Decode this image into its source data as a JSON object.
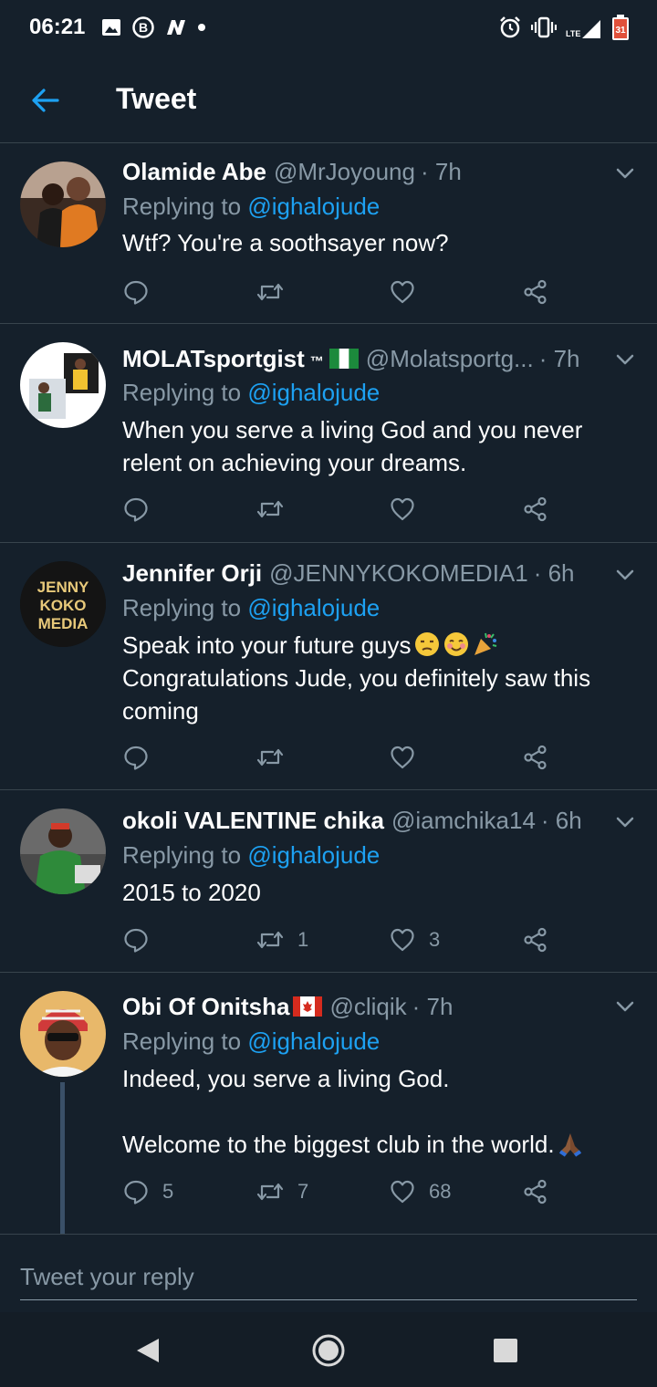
{
  "status_bar": {
    "time": "06:21",
    "left_icons": [
      "image-icon",
      "b-circle-icon",
      "n-icon",
      "dot-icon"
    ],
    "right_icons": [
      "alarm-icon",
      "vibrate-icon",
      "lte-signal-icon",
      "battery-icon"
    ],
    "network": "LTE",
    "battery": "31"
  },
  "header": {
    "title": "Tweet"
  },
  "tweets": [
    {
      "name": "Olamide Abe",
      "handle": "@MrJoyoung",
      "time": "· 7h",
      "replying_label": "Replying to",
      "replying_to": "@ighalojude",
      "text": "Wtf? You're a soothsayer now?",
      "replies": "",
      "retweets": "",
      "likes": ""
    },
    {
      "name": "MOLATsportgist",
      "name_suffix": "™",
      "flag": "nigeria",
      "handle": "@Molatsportg...",
      "time": "· 7h",
      "replying_label": "Replying to",
      "replying_to": "@ighalojude",
      "text": "When you serve a living God and you never relent on achieving your dreams.",
      "replies": "",
      "retweets": "",
      "likes": ""
    },
    {
      "name": "Jennifer Orji",
      "handle": "@JENNYKOKOMEDIA1",
      "time": "· 6h",
      "replying_label": "Replying to",
      "replying_to": "@ighalojude",
      "text_line1": "Speak into your future guys",
      "text_line2": "Congratulations Jude, you definitely saw this coming",
      "avatar_text": [
        "JENNY",
        "KOKO",
        "MEDIA"
      ],
      "emojis": [
        "unamused-face",
        "smiling-face",
        "party-popper"
      ],
      "replies": "",
      "retweets": "",
      "likes": ""
    },
    {
      "name": "okoli VALENTINE chika",
      "handle": "@iamchika14",
      "time": "· 6h",
      "replying_label": "Replying to",
      "replying_to": "@ighalojude",
      "text": "2015 to 2020",
      "replies": "",
      "retweets": "1",
      "likes": "3"
    },
    {
      "name": "Obi Of Onitsha",
      "flag": "canada",
      "handle": "@cliqik",
      "time": "· 7h",
      "replying_label": "Replying to",
      "replying_to": "@ighalojude",
      "text_line1": "Indeed, you serve a living God.",
      "text_line2": "Welcome to the biggest club in the world.",
      "emojis": [
        "folded-hands"
      ],
      "replies": "5",
      "retweets": "7",
      "likes": "68"
    }
  ],
  "reply_box": {
    "placeholder": "Tweet your reply"
  },
  "nav": [
    "back-triangle-icon",
    "home-circle-icon",
    "recents-square-icon"
  ],
  "colors": {
    "background": "#15202b",
    "divider": "#38444d",
    "secondary_text": "#8899a6",
    "accent": "#1da1f2"
  }
}
